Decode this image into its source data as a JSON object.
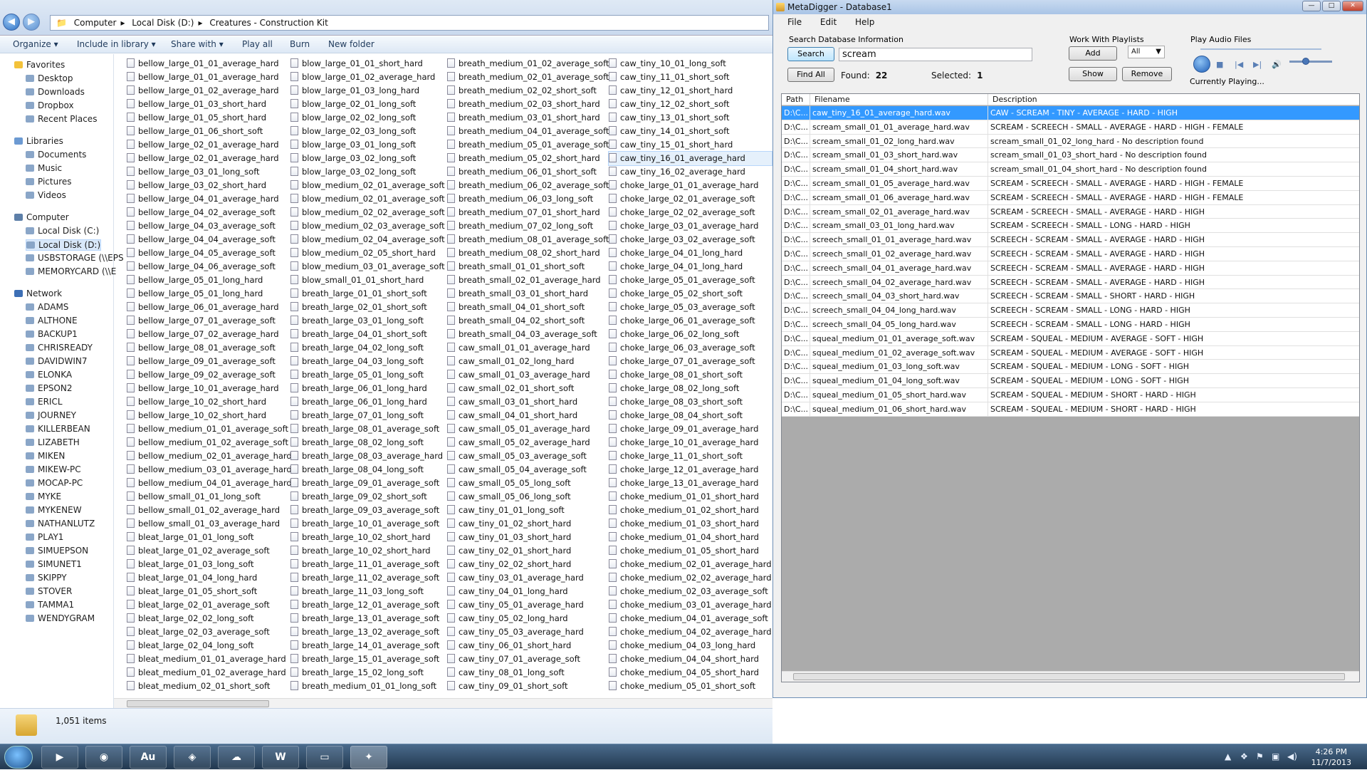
{
  "explorer": {
    "breadcrumb": [
      "Computer",
      "Local Disk (D:)",
      "Creatures - Construction Kit"
    ],
    "toolbar": [
      "Organize ▾",
      "Include in library ▾",
      "Share with ▾",
      "Play all",
      "Burn",
      "New folder"
    ],
    "nav": [
      {
        "label": "Favorites",
        "type": "header",
        "icon": "star-icon"
      },
      {
        "label": "Desktop"
      },
      {
        "label": "Downloads"
      },
      {
        "label": "Dropbox"
      },
      {
        "label": "Recent Places"
      },
      {
        "label": "Libraries",
        "type": "header",
        "icon": "library-icon"
      },
      {
        "label": "Documents"
      },
      {
        "label": "Music"
      },
      {
        "label": "Pictures"
      },
      {
        "label": "Videos"
      },
      {
        "label": "Computer",
        "type": "header",
        "icon": "computer-icon"
      },
      {
        "label": "Local Disk (C:)"
      },
      {
        "label": "Local Disk (D:)",
        "selected": true
      },
      {
        "label": "USBSTORAGE (\\\\EPS"
      },
      {
        "label": "MEMORYCARD (\\\\E"
      },
      {
        "label": "Network",
        "type": "header",
        "icon": "network-icon"
      },
      {
        "label": "ADAMS"
      },
      {
        "label": "ALTHONE"
      },
      {
        "label": "BACKUP1"
      },
      {
        "label": "CHRISREADY"
      },
      {
        "label": "DAVIDWIN7"
      },
      {
        "label": "ELONKA"
      },
      {
        "label": "EPSON2"
      },
      {
        "label": "ERICL"
      },
      {
        "label": "JOURNEY"
      },
      {
        "label": "KILLERBEAN"
      },
      {
        "label": "LIZABETH"
      },
      {
        "label": "MIKEN"
      },
      {
        "label": "MIKEW-PC"
      },
      {
        "label": "MOCAP-PC"
      },
      {
        "label": "MYKE"
      },
      {
        "label": "MYKENEW"
      },
      {
        "label": "NATHANLUTZ"
      },
      {
        "label": "PLAY1"
      },
      {
        "label": "SIMUEPSON"
      },
      {
        "label": "SIMUNET1"
      },
      {
        "label": "SKIPPY"
      },
      {
        "label": "STOVER"
      },
      {
        "label": "TAMMA1"
      },
      {
        "label": "WENDYGRAM"
      }
    ],
    "columns": [
      [
        "bellow_large_01_01_average_hard",
        "bellow_large_01_01_average_hard",
        "bellow_large_01_02_average_hard",
        "bellow_large_01_03_short_hard",
        "bellow_large_01_05_short_hard",
        "bellow_large_01_06_short_soft",
        "bellow_large_02_01_average_hard",
        "bellow_large_02_01_average_hard",
        "bellow_large_03_01_long_soft",
        "bellow_large_03_02_short_hard",
        "bellow_large_04_01_average_hard",
        "bellow_large_04_02_average_soft",
        "bellow_large_04_03_average_soft",
        "bellow_large_04_04_average_soft",
        "bellow_large_04_05_average_soft",
        "bellow_large_04_06_average_soft",
        "bellow_large_05_01_long_hard",
        "bellow_large_05_01_long_hard",
        "bellow_large_06_01_average_hard",
        "bellow_large_07_01_average_soft",
        "bellow_large_07_02_average_hard",
        "bellow_large_08_01_average_soft",
        "bellow_large_09_01_average_soft",
        "bellow_large_09_02_average_soft",
        "bellow_large_10_01_average_hard",
        "bellow_large_10_02_short_hard",
        "bellow_large_10_02_short_hard",
        "bellow_medium_01_01_average_soft",
        "bellow_medium_01_02_average_soft",
        "bellow_medium_02_01_average_hard",
        "bellow_medium_03_01_average_hard",
        "bellow_medium_04_01_average_hard",
        "bellow_small_01_01_long_soft",
        "bellow_small_01_02_average_hard",
        "bellow_small_01_03_average_hard",
        "bleat_large_01_01_long_soft",
        "bleat_large_01_02_average_soft",
        "bleat_large_01_03_long_soft",
        "bleat_large_01_04_long_hard",
        "bleat_large_01_05_short_soft",
        "bleat_large_02_01_average_soft",
        "bleat_large_02_02_long_soft",
        "bleat_large_02_03_average_soft",
        "bleat_large_02_04_long_soft",
        "bleat_medium_01_01_average_hard",
        "bleat_medium_01_02_average_hard",
        "bleat_medium_02_01_short_soft"
      ],
      [
        "blow_large_01_01_short_hard",
        "blow_large_01_02_average_hard",
        "blow_large_01_03_long_hard",
        "blow_large_02_01_long_soft",
        "blow_large_02_02_long_soft",
        "blow_large_02_03_long_soft",
        "blow_large_03_01_long_soft",
        "blow_large_03_02_long_soft",
        "blow_large_03_02_long_soft",
        "blow_medium_02_01_average_soft",
        "blow_medium_02_01_average_soft",
        "blow_medium_02_02_average_soft",
        "blow_medium_02_03_average_soft",
        "blow_medium_02_04_average_soft",
        "blow_medium_02_05_short_hard",
        "blow_medium_03_01_average_soft",
        "blow_small_01_01_short_hard",
        "breath_large_01_01_short_soft",
        "breath_large_02_01_short_soft",
        "breath_large_03_01_long_soft",
        "breath_large_04_01_short_soft",
        "breath_large_04_02_long_soft",
        "breath_large_04_03_long_soft",
        "breath_large_05_01_long_soft",
        "breath_large_06_01_long_hard",
        "breath_large_06_01_long_hard",
        "breath_large_07_01_long_soft",
        "breath_large_08_01_average_soft",
        "breath_large_08_02_long_soft",
        "breath_large_08_03_average_hard",
        "breath_large_08_04_long_soft",
        "breath_large_09_01_average_soft",
        "breath_large_09_02_short_soft",
        "breath_large_09_03_average_soft",
        "breath_large_10_01_average_soft",
        "breath_large_10_02_short_hard",
        "breath_large_10_02_short_hard",
        "breath_large_11_01_average_soft",
        "breath_large_11_02_average_soft",
        "breath_large_11_03_long_soft",
        "breath_large_12_01_average_soft",
        "breath_large_13_01_average_soft",
        "breath_large_13_02_average_soft",
        "breath_large_14_01_average_soft",
        "breath_large_15_01_average_soft",
        "breath_large_15_02_long_soft",
        "breath_medium_01_01_long_soft"
      ],
      [
        "breath_medium_01_02_average_soft",
        "breath_medium_02_01_average_soft",
        "breath_medium_02_02_short_soft",
        "breath_medium_02_03_short_hard",
        "breath_medium_03_01_short_hard",
        "breath_medium_04_01_average_soft",
        "breath_medium_05_01_average_soft",
        "breath_medium_05_02_short_hard",
        "breath_medium_06_01_short_soft",
        "breath_medium_06_02_average_soft",
        "breath_medium_06_03_long_soft",
        "breath_medium_07_01_short_hard",
        "breath_medium_07_02_long_soft",
        "breath_medium_08_01_average_soft",
        "breath_medium_08_02_short_hard",
        "breath_small_01_01_short_soft",
        "breath_small_02_01_average_hard",
        "breath_small_03_01_short_hard",
        "breath_small_04_01_short_soft",
        "breath_small_04_02_short_soft",
        "breath_small_04_03_average_soft",
        "caw_small_01_01_average_hard",
        "caw_small_01_02_long_hard",
        "caw_small_01_03_average_hard",
        "caw_small_02_01_short_soft",
        "caw_small_03_01_short_hard",
        "caw_small_04_01_short_hard",
        "caw_small_05_01_average_hard",
        "caw_small_05_02_average_hard",
        "caw_small_05_03_average_soft",
        "caw_small_05_04_average_soft",
        "caw_small_05_05_long_soft",
        "caw_small_05_06_long_soft",
        "caw_tiny_01_01_long_soft",
        "caw_tiny_01_02_short_hard",
        "caw_tiny_01_03_short_hard",
        "caw_tiny_02_01_short_hard",
        "caw_tiny_02_02_short_hard",
        "caw_tiny_03_01_average_hard",
        "caw_tiny_04_01_long_hard",
        "caw_tiny_05_01_average_hard",
        "caw_tiny_05_02_long_hard",
        "caw_tiny_05_03_average_hard",
        "caw_tiny_06_01_short_hard",
        "caw_tiny_07_01_average_soft",
        "caw_tiny_08_01_long_soft",
        "caw_tiny_09_01_short_soft"
      ],
      [
        "caw_tiny_10_01_long_soft",
        "caw_tiny_11_01_short_soft",
        "caw_tiny_12_01_short_hard",
        "caw_tiny_12_02_short_soft",
        "caw_tiny_13_01_short_soft",
        "caw_tiny_14_01_short_soft",
        "caw_tiny_15_01_short_hard",
        "caw_tiny_16_01_average_hard",
        "caw_tiny_16_02_average_hard",
        "choke_large_01_01_average_hard",
        "choke_large_02_01_average_soft",
        "choke_large_02_02_average_soft",
        "choke_large_03_01_average_hard",
        "choke_large_03_02_average_soft",
        "choke_large_04_01_long_hard",
        "choke_large_04_01_long_hard",
        "choke_large_05_01_average_soft",
        "choke_large_05_02_short_soft",
        "choke_large_05_03_average_soft",
        "choke_large_06_01_average_soft",
        "choke_large_06_02_long_soft",
        "choke_large_06_03_average_soft",
        "choke_large_07_01_average_soft",
        "choke_large_08_01_short_soft",
        "choke_large_08_02_long_soft",
        "choke_large_08_03_short_soft",
        "choke_large_08_04_short_soft",
        "choke_large_09_01_average_hard",
        "choke_large_10_01_average_hard",
        "choke_large_11_01_short_soft",
        "choke_large_12_01_average_hard",
        "choke_large_13_01_average_hard",
        "choke_medium_01_01_short_hard",
        "choke_medium_01_02_short_hard",
        "choke_medium_01_03_short_hard",
        "choke_medium_01_04_short_hard",
        "choke_medium_01_05_short_hard",
        "choke_medium_02_01_average_hard",
        "choke_medium_02_02_average_hard",
        "choke_medium_02_03_average_soft",
        "choke_medium_03_01_average_hard",
        "choke_medium_04_01_average_soft",
        "choke_medium_04_02_average_hard",
        "choke_medium_04_03_long_hard",
        "choke_medium_04_04_short_hard",
        "choke_medium_04_05_short_hard",
        "choke_medium_05_01_short_soft"
      ]
    ],
    "status_count": "1,051 items"
  },
  "metadigger": {
    "title": "MetaDigger - Database1",
    "menu": [
      "File",
      "Edit",
      "Help"
    ],
    "search_group": "Search Database Information",
    "search_button": "Search",
    "search_value": "scream",
    "findall_button": "Find All",
    "found_label": "Found:",
    "found_value": "22",
    "selected_label": "Selected:",
    "selected_value": "1",
    "playlist_group": "Work With Playlists",
    "add_button": "Add",
    "playlist_select": "All",
    "show_button": "Show",
    "remove_button": "Remove",
    "audio_group": "Play Audio Files",
    "now_playing": "Currently Playing...",
    "volume": 0.38,
    "columns": [
      "Path",
      "Filename",
      "Description"
    ],
    "rows": [
      {
        "path": "D:\\C...",
        "file": "caw_tiny_16_01_average_hard.wav",
        "desc": "CAW - SCREAM - TINY - AVERAGE - HARD - HIGH",
        "selected": true
      },
      {
        "path": "D:\\C...",
        "file": "scream_small_01_01_average_hard.wav",
        "desc": "SCREAM - SCREECH - SMALL - AVERAGE - HARD - HIGH - FEMALE"
      },
      {
        "path": "D:\\C...",
        "file": "scream_small_01_02_long_hard.wav",
        "desc": "scream_small_01_02_long_hard - No description found"
      },
      {
        "path": "D:\\C...",
        "file": "scream_small_01_03_short_hard.wav",
        "desc": "scream_small_01_03_short_hard - No description found"
      },
      {
        "path": "D:\\C...",
        "file": "scream_small_01_04_short_hard.wav",
        "desc": "scream_small_01_04_short_hard - No description found"
      },
      {
        "path": "D:\\C...",
        "file": "scream_small_01_05_average_hard.wav",
        "desc": "SCREAM - SCREECH - SMALL - AVERAGE - HARD - HIGH - FEMALE"
      },
      {
        "path": "D:\\C...",
        "file": "scream_small_01_06_average_hard.wav",
        "desc": "SCREAM - SCREECH - SMALL - AVERAGE - HARD - HIGH - FEMALE"
      },
      {
        "path": "D:\\C...",
        "file": "scream_small_02_01_average_hard.wav",
        "desc": "SCREAM - SCREECH - SMALL - AVERAGE - HARD - HIGH"
      },
      {
        "path": "D:\\C...",
        "file": "scream_small_03_01_long_hard.wav",
        "desc": "SCREAM - SCREECH - SMALL - LONG - HARD - HIGH"
      },
      {
        "path": "D:\\C...",
        "file": "screech_small_01_01_average_hard.wav",
        "desc": "SCREECH - SCREAM - SMALL - AVERAGE - HARD - HIGH"
      },
      {
        "path": "D:\\C...",
        "file": "screech_small_01_02_average_hard.wav",
        "desc": "SCREECH - SCREAM - SMALL - AVERAGE - HARD - HIGH"
      },
      {
        "path": "D:\\C...",
        "file": "screech_small_04_01_average_hard.wav",
        "desc": "SCREECH - SCREAM - SMALL - AVERAGE - HARD - HIGH"
      },
      {
        "path": "D:\\C...",
        "file": "screech_small_04_02_average_hard.wav",
        "desc": "SCREECH - SCREAM - SMALL - AVERAGE - HARD - HIGH"
      },
      {
        "path": "D:\\C...",
        "file": "screech_small_04_03_short_hard.wav",
        "desc": "SCREECH - SCREAM - SMALL - SHORT - HARD - HIGH"
      },
      {
        "path": "D:\\C...",
        "file": "screech_small_04_04_long_hard.wav",
        "desc": "SCREECH - SCREAM - SMALL - LONG - HARD - HIGH"
      },
      {
        "path": "D:\\C...",
        "file": "screech_small_04_05_long_hard.wav",
        "desc": "SCREECH - SCREAM - SMALL - LONG - HARD - HIGH"
      },
      {
        "path": "D:\\C...",
        "file": "squeal_medium_01_01_average_soft.wav",
        "desc": "SCREAM - SQUEAL - MEDIUM - AVERAGE - SOFT - HIGH"
      },
      {
        "path": "D:\\C...",
        "file": "squeal_medium_01_02_average_soft.wav",
        "desc": "SCREAM - SQUEAL - MEDIUM - AVERAGE - SOFT - HIGH"
      },
      {
        "path": "D:\\C...",
        "file": "squeal_medium_01_03_long_soft.wav",
        "desc": "SCREAM - SQUEAL - MEDIUM - LONG - SOFT - HIGH"
      },
      {
        "path": "D:\\C...",
        "file": "squeal_medium_01_04_long_soft.wav",
        "desc": "SCREAM - SQUEAL - MEDIUM - LONG - SOFT - HIGH"
      },
      {
        "path": "D:\\C...",
        "file": "squeal_medium_01_05_short_hard.wav",
        "desc": "SCREAM - SQUEAL - MEDIUM - SHORT - HARD - HIGH"
      },
      {
        "path": "D:\\C...",
        "file": "squeal_medium_01_06_short_hard.wav",
        "desc": "SCREAM - SQUEAL - MEDIUM - SHORT - HARD - HIGH"
      }
    ]
  },
  "taskbar": {
    "apps": [
      {
        "name": "media-player",
        "glyph": "▶"
      },
      {
        "name": "chrome",
        "glyph": "◉"
      },
      {
        "name": "audition",
        "glyph": "Au"
      },
      {
        "name": "unity",
        "glyph": "◈"
      },
      {
        "name": "messenger",
        "glyph": "☁"
      },
      {
        "name": "word",
        "glyph": "W"
      },
      {
        "name": "explorer",
        "glyph": "▭"
      },
      {
        "name": "metadigger",
        "glyph": "✦",
        "active": true
      }
    ],
    "time": "4:26 PM",
    "date": "11/7/2013"
  }
}
